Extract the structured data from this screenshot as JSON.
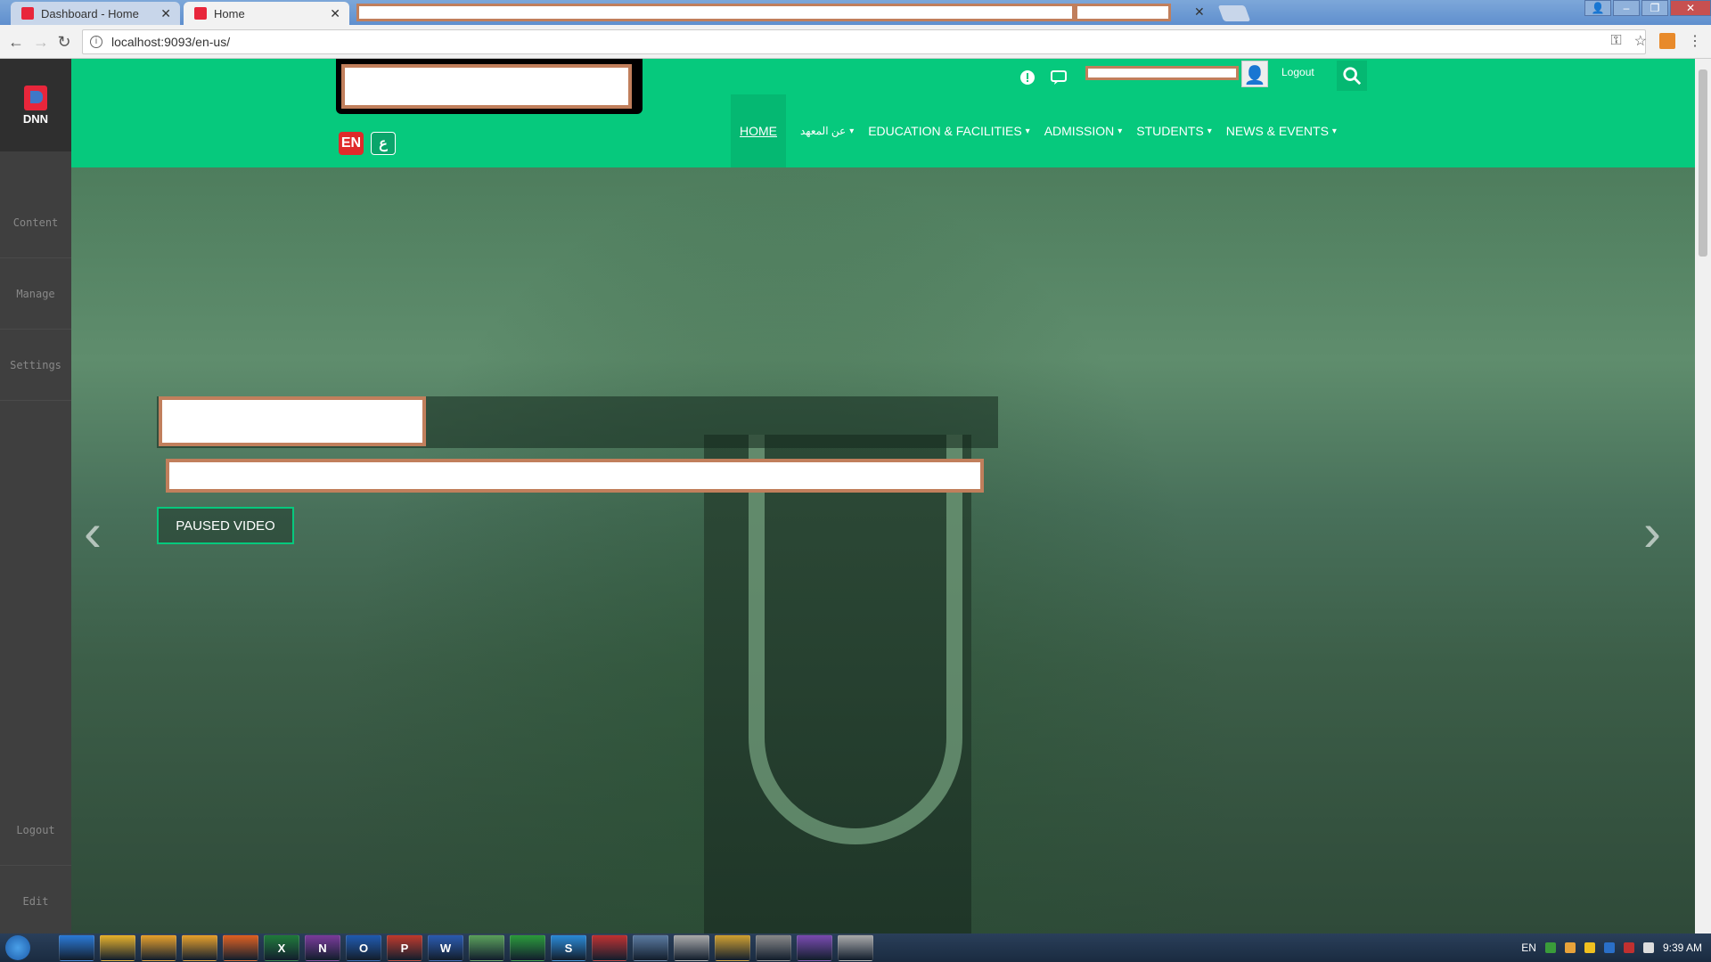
{
  "browser": {
    "tabs": [
      {
        "title": "Dashboard - Home"
      },
      {
        "title": "Home"
      }
    ],
    "url": "localhost:9093/en-us/"
  },
  "sidebar": {
    "logo_text": "DNN",
    "items": [
      "Content",
      "Manage",
      "Settings",
      "Logout",
      "Edit"
    ]
  },
  "header": {
    "logout": "Logout",
    "lang_en": "EN",
    "lang_ar": "ع"
  },
  "nav": {
    "items": [
      {
        "label": "HOME",
        "caret": ""
      },
      {
        "label": "عن المعهد",
        "caret": "▾"
      },
      {
        "label": "EDUCATION & FACILITIES",
        "caret": "▾"
      },
      {
        "label": "ADMISSION",
        "caret": "▾"
      },
      {
        "label": "STUDENTS",
        "caret": "▾"
      },
      {
        "label": "NEWS & EVENTS",
        "caret": "▾"
      }
    ]
  },
  "hero": {
    "button_label": "PAUSED VIDEO",
    "prev_arrow": "‹",
    "next_arrow": "›"
  },
  "taskbar": {
    "apps": [
      "",
      "",
      "",
      "",
      "",
      "X",
      "N",
      "O",
      "P",
      "W",
      "",
      "",
      "S",
      "",
      "",
      "",
      "",
      "",
      "",
      ""
    ],
    "lang": "EN",
    "time": "9:39 AM"
  }
}
